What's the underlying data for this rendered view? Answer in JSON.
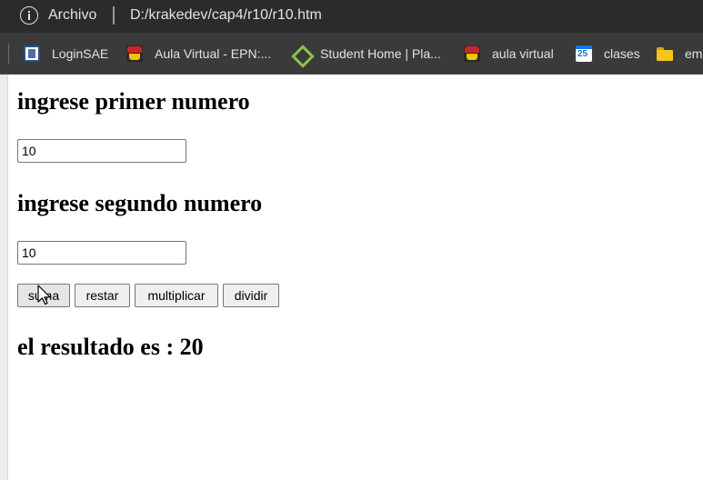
{
  "browser": {
    "address_label": "Archivo",
    "url": "D:/krakedev/cap4/r10/r10.htm",
    "bookmarks": [
      {
        "label": "LoginSAE",
        "icon": "login-sae-icon"
      },
      {
        "label": "Aula Virtual - EPN:...",
        "icon": "owl-icon"
      },
      {
        "label": "Student Home | Pla...",
        "icon": "diamond-icon"
      },
      {
        "label": "aula virtual",
        "icon": "owl-icon"
      },
      {
        "label": "clases",
        "icon": "calendar-icon"
      },
      {
        "label": "em",
        "icon": "folder-icon"
      }
    ]
  },
  "page": {
    "first_label": "ingrese primer numero",
    "first_value": "10",
    "second_label": "ingrese segundo numero",
    "second_value": "10",
    "buttons": {
      "sum": "suma",
      "subtract": "restar",
      "multiply": "multiplicar",
      "divide": "dividir"
    },
    "result": "el resultado es : 20"
  }
}
